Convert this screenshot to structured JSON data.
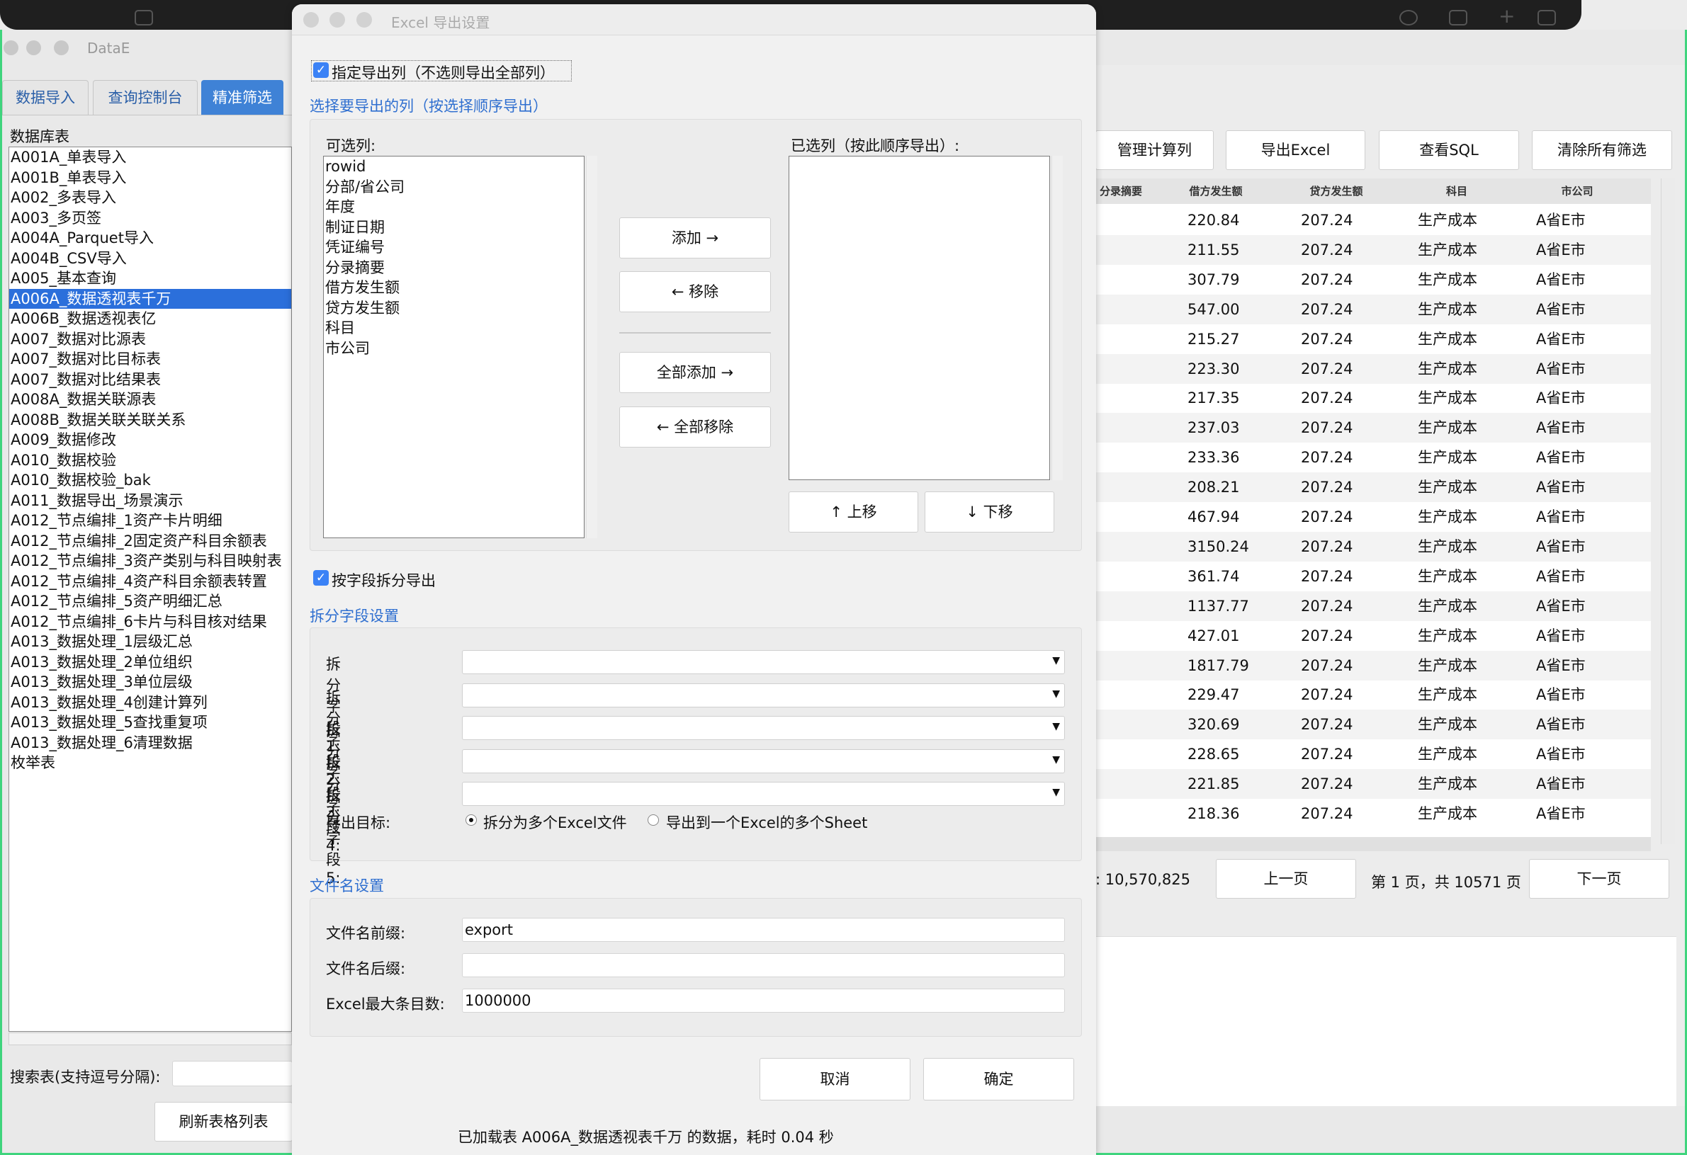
{
  "main": {
    "title": "DataE",
    "tabs": [
      "数据导入",
      "查询控制台",
      "精准筛选"
    ],
    "db_label": "数据库表",
    "tables": [
      "A001A_单表导入",
      "A001B_单表导入",
      "A002_多表导入",
      "A003_多页签",
      "A004A_Parquet导入",
      "A004B_CSV导入",
      "A005_基本查询",
      "A006A_数据透视表千万",
      "A006B_数据透视表亿",
      "A007_数据对比源表",
      "A007_数据对比目标表",
      "A007_数据对比结果表",
      "A008A_数据关联源表",
      "A008B_数据关联关联关系",
      "A009_数据修改",
      "A010_数据校验",
      "A010_数据校验_bak",
      "A011_数据导出_场景演示",
      "A012_节点编排_1资产卡片明细",
      "A012_节点编排_2固定资产科目余额表",
      "A012_节点编排_3资产类别与科目映射表",
      "A012_节点编排_4资产科目余额表转置",
      "A012_节点编排_5资产明细汇总",
      "A012_节点编排_6卡片与科目核对结果",
      "A013_数据处理_1层级汇总",
      "A013_数据处理_2单位组织",
      "A013_数据处理_3单位层级",
      "A013_数据处理_4创建计算列",
      "A013_数据处理_5查找重复项",
      "A013_数据处理_6清理数据",
      "枚举表"
    ],
    "selected_table_index": 7,
    "search_label": "搜索表(支持逗号分隔):",
    "refresh_button": "刷新表格列表",
    "toolbar": [
      "管理计算列",
      "导出Excel",
      "查看SQL",
      "清除所有筛选"
    ],
    "columns": [
      "分录摘要",
      "借方发生额",
      "贷方发生额",
      "科目",
      "市公司"
    ],
    "rows": [
      [
        "220.84",
        "207.24",
        "生产成本",
        "A省E市"
      ],
      [
        "211.55",
        "207.24",
        "生产成本",
        "A省E市"
      ],
      [
        "307.79",
        "207.24",
        "生产成本",
        "A省E市"
      ],
      [
        "547.00",
        "207.24",
        "生产成本",
        "A省E市"
      ],
      [
        "215.27",
        "207.24",
        "生产成本",
        "A省E市"
      ],
      [
        "223.30",
        "207.24",
        "生产成本",
        "A省E市"
      ],
      [
        "217.35",
        "207.24",
        "生产成本",
        "A省E市"
      ],
      [
        "237.03",
        "207.24",
        "生产成本",
        "A省E市"
      ],
      [
        "233.36",
        "207.24",
        "生产成本",
        "A省E市"
      ],
      [
        "208.21",
        "207.24",
        "生产成本",
        "A省E市"
      ],
      [
        "467.94",
        "207.24",
        "生产成本",
        "A省E市"
      ],
      [
        "3150.24",
        "207.24",
        "生产成本",
        "A省E市"
      ],
      [
        "361.74",
        "207.24",
        "生产成本",
        "A省E市"
      ],
      [
        "1137.77",
        "207.24",
        "生产成本",
        "A省E市"
      ],
      [
        "427.01",
        "207.24",
        "生产成本",
        "A省E市"
      ],
      [
        "1817.79",
        "207.24",
        "生产成本",
        "A省E市"
      ],
      [
        "229.47",
        "207.24",
        "生产成本",
        "A省E市"
      ],
      [
        "320.69",
        "207.24",
        "生产成本",
        "A省E市"
      ],
      [
        "228.65",
        "207.24",
        "生产成本",
        "A省E市"
      ],
      [
        "221.85",
        "207.24",
        "生产成本",
        "A省E市"
      ],
      [
        "218.36",
        "207.24",
        "生产成本",
        "A省E市"
      ]
    ],
    "pagination": {
      "total": ": 10,570,825",
      "prev": "上一页",
      "info": "第 1 页，共 10571 页",
      "next": "下一页"
    },
    "status": "已加载表 A006A_数据透视表千万 的数据，耗时 0.04 秒"
  },
  "dialog": {
    "title": "Excel 导出设置",
    "specify_columns": "指定导出列（不选则导出全部列）",
    "select_section": "选择要导出的列（按选择顺序导出）",
    "available_label": "可选列:",
    "available": [
      "rowid",
      "分部/省公司",
      "年度",
      "制证日期",
      "凭证编号",
      "分录摘要",
      "借方发生额",
      "贷方发生额",
      "科目",
      "市公司"
    ],
    "selected_label": "已选列（按此顺序导出）:",
    "add": "添加 →",
    "remove": "← 移除",
    "add_all": "全部添加 →",
    "remove_all": "← 全部移除",
    "move_up": "↑ 上移",
    "move_down": "↓ 下移",
    "split_check": "按字段拆分导出",
    "split_section": "拆分字段设置",
    "split_fields": [
      "拆分字段1:",
      "拆分字段2:",
      "拆分字段3:",
      "拆分字段4:",
      "拆分字段5:"
    ],
    "target_label": "导出目标:",
    "target_files": "拆分为多个Excel文件",
    "target_sheets": "导出到一个Excel的多个Sheet",
    "filename_section": "文件名设置",
    "prefix_label": "文件名前缀:",
    "prefix_value": "export",
    "suffix_label": "文件名后缀:",
    "suffix_value": "",
    "max_label": "Excel最大条目数:",
    "max_value": "1000000",
    "cancel": "取消",
    "ok": "确定"
  },
  "colors": {
    "accent": "#3b82f6",
    "selection": "#2b6fdb",
    "section": "#2f6fd0"
  }
}
